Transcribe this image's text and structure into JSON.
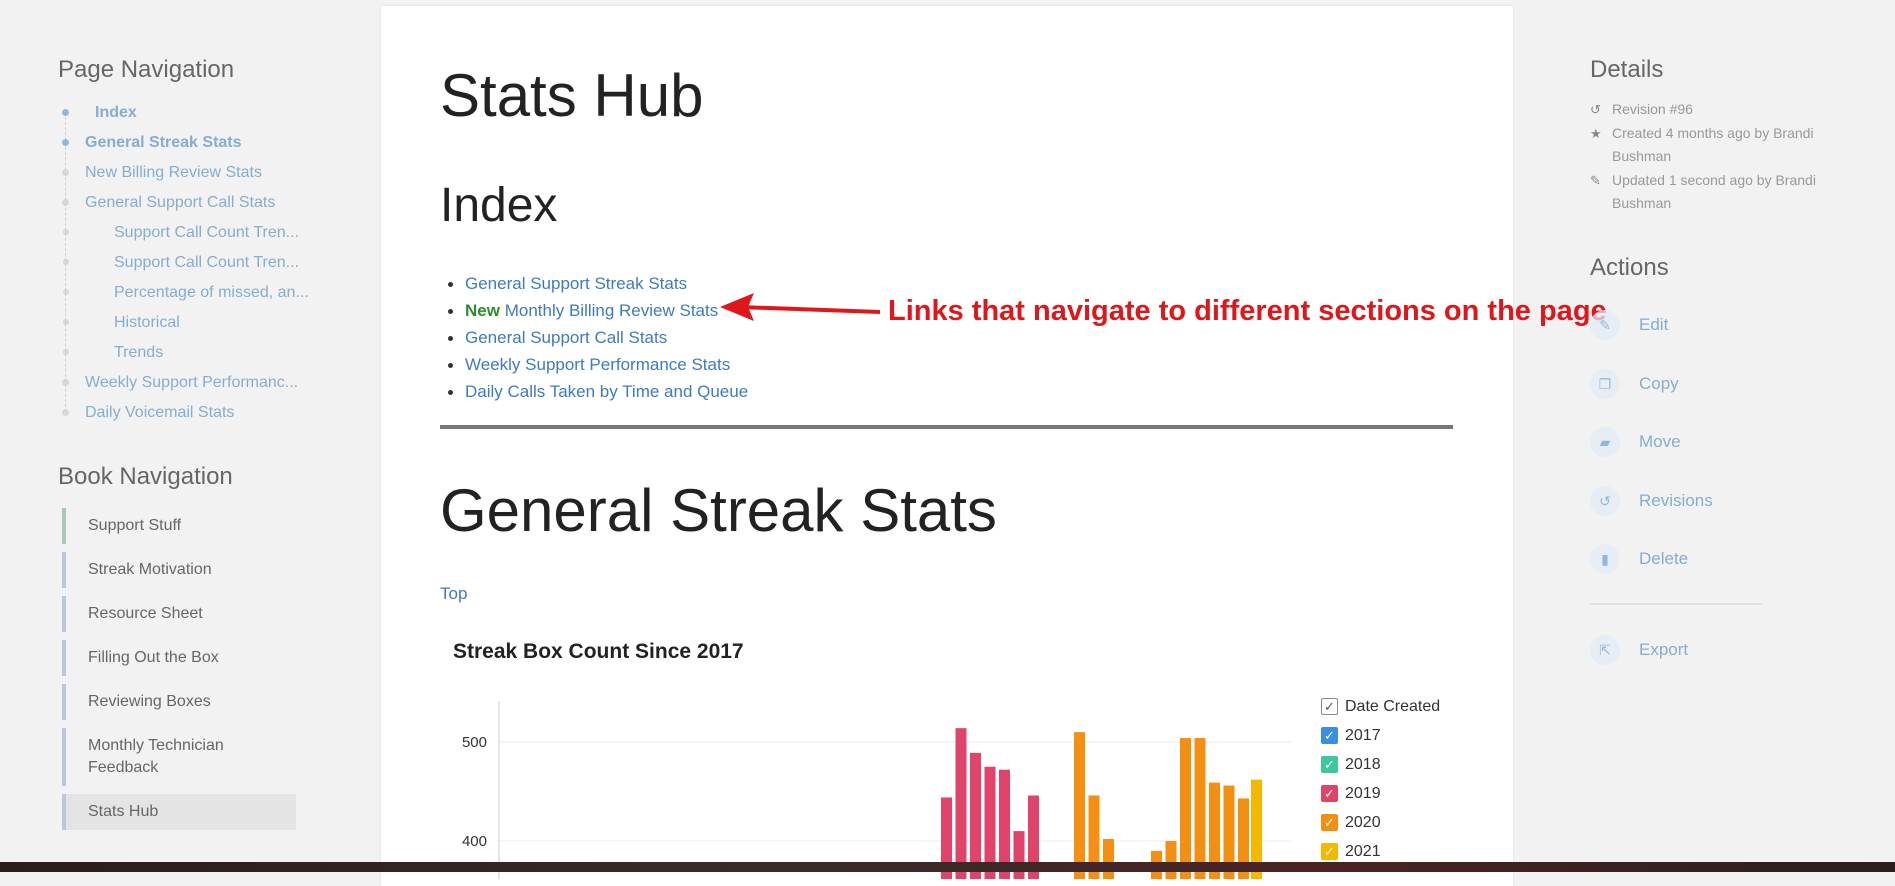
{
  "page_nav": {
    "title": "Page Navigation",
    "items": [
      {
        "label": "Index",
        "level": 1,
        "active": true
      },
      {
        "label": "General Streak Stats",
        "level": 1,
        "active": true
      },
      {
        "label": "New Billing Review Stats",
        "level": 1,
        "active": false
      },
      {
        "label": "General Support Call Stats",
        "level": 1,
        "active": false
      },
      {
        "label": "Support Call Count Tren...",
        "level": 2,
        "active": false
      },
      {
        "label": "Support Call Count Tren...",
        "level": 2,
        "active": false
      },
      {
        "label": "Percentage of missed, an...",
        "level": 2,
        "active": false
      },
      {
        "label": "Historical",
        "level": 2,
        "active": false
      },
      {
        "label": "Trends",
        "level": 2,
        "active": false
      },
      {
        "label": "Weekly Support Performanc...",
        "level": 1,
        "active": false
      },
      {
        "label": "Daily Voicemail Stats",
        "level": 1,
        "active": false
      }
    ]
  },
  "book_nav": {
    "title": "Book Navigation",
    "items": [
      {
        "label": "Support Stuff"
      },
      {
        "label": "Streak Motivation"
      },
      {
        "label": "Resource Sheet"
      },
      {
        "label": "Filling Out the Box"
      },
      {
        "label": "Reviewing Boxes"
      },
      {
        "label": "Monthly Technician Feedback"
      },
      {
        "label": "Stats Hub"
      }
    ]
  },
  "main": {
    "title": "Stats Hub",
    "index_heading": "Index",
    "index_links": [
      {
        "badge": "",
        "label": "General Support Streak Stats"
      },
      {
        "badge": "New",
        "label": "Monthly Billing Review Stats"
      },
      {
        "badge": "",
        "label": "General Support Call Stats"
      },
      {
        "badge": "",
        "label": "Weekly Support Performance Stats"
      },
      {
        "badge": "",
        "label": "Daily Calls Taken by Time and Queue"
      }
    ],
    "section_title": "General Streak Stats",
    "top_link": "Top"
  },
  "annotation": {
    "text": "Links that navigate to different sections on the page",
    "color": "#e0171a"
  },
  "details": {
    "title": "Details",
    "revision": "Revision #96",
    "created": "Created 4 months ago by Brandi Bushman",
    "updated": "Updated 1 second ago by Brandi Bushman"
  },
  "actions": {
    "title": "Actions",
    "items": [
      {
        "label": "Edit",
        "icon": "pencil-icon"
      },
      {
        "label": "Copy",
        "icon": "copy-icon"
      },
      {
        "label": "Move",
        "icon": "folder-icon"
      },
      {
        "label": "Revisions",
        "icon": "history-icon"
      },
      {
        "label": "Delete",
        "icon": "trash-icon"
      }
    ],
    "export": {
      "label": "Export",
      "icon": "export-icon"
    }
  },
  "chart_data": {
    "type": "bar",
    "title": "Streak Box Count Since 2017",
    "ylim": [
      300,
      560
    ],
    "yticks": [
      400,
      500
    ],
    "legend": {
      "header": "Date Created",
      "entries": [
        {
          "name": "2017",
          "color": "#3d8ee0"
        },
        {
          "name": "2018",
          "color": "#3cc7a1"
        },
        {
          "name": "2019",
          "color": "#e0446b"
        },
        {
          "name": "2020",
          "color": "#f38f12"
        },
        {
          "name": "2021",
          "color": "#f5b800"
        }
      ]
    },
    "series": [
      {
        "name": "2019",
        "values": [
          444,
          514,
          489,
          475,
          472,
          410,
          446
        ]
      },
      {
        "name": "2020",
        "values": [
          510,
          446,
          402
        ]
      },
      {
        "name": "2020",
        "values": [
          390,
          400,
          504,
          504,
          459,
          456,
          443
        ]
      },
      {
        "name": "2021",
        "values": [
          462
        ]
      }
    ]
  }
}
